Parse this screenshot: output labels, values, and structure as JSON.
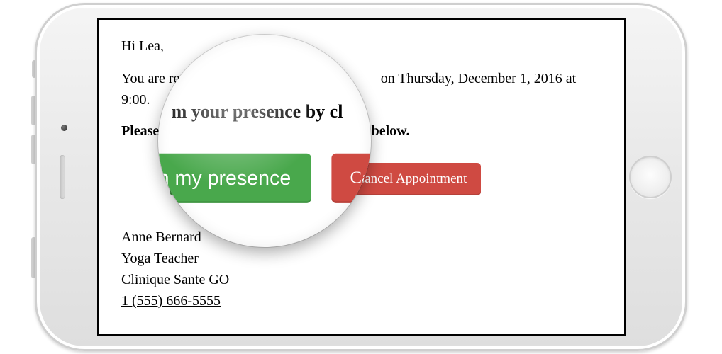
{
  "email": {
    "greeting": "Hi Lea,",
    "body_line_prefix": "You are registered",
    "body_line_suffix": "on Thursday, December 1, 2016 at 9:00.",
    "instruction_prefix": "Please conf",
    "instruction_mid": "m your presence by cl",
    "instruction_suffix": "g below.",
    "buttons": {
      "confirm": "Confirm my presence",
      "cancel": "Cancel Appointment"
    },
    "signature": {
      "name": "Anne Bernard",
      "title": "Yoga Teacher",
      "clinic": "Clinique Sante GO",
      "phone": "1 (555) 666-5555"
    }
  },
  "colors": {
    "confirm": "#49a84c",
    "cancel": "#cf4a42"
  }
}
